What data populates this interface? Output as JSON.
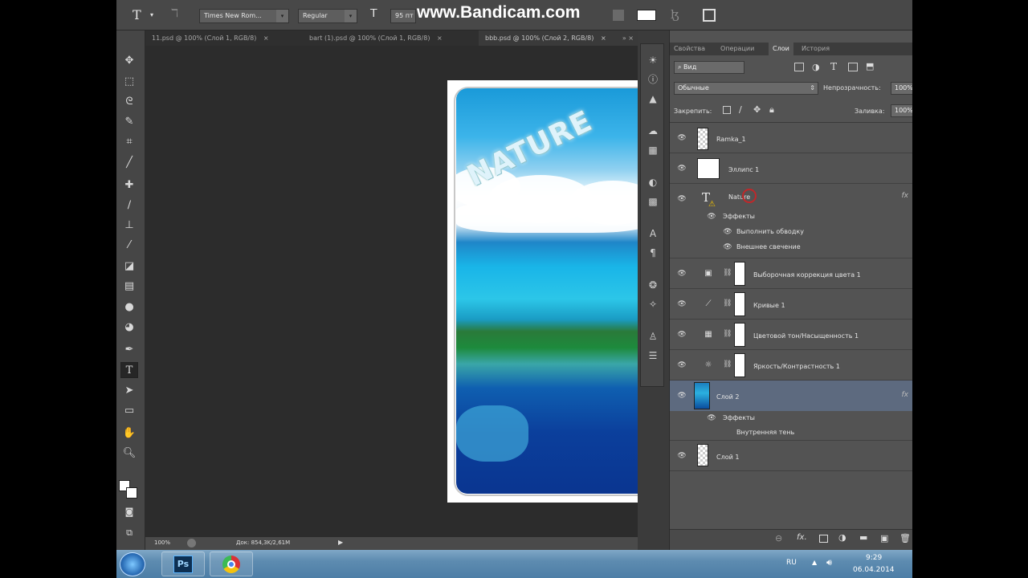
{
  "watermark": "www.Bandicam.com",
  "options_bar": {
    "tool_glyph": "T",
    "font_family": "Times New Rom...",
    "font_style": "Regular",
    "font_size": "95 пт"
  },
  "tabs": [
    {
      "label": "11.psd @ 100% (Слой 1, RGB/8)",
      "close": "×"
    },
    {
      "label": "bart (1).psd @ 100% (Слой 1, RGB/8)",
      "close": "×"
    },
    {
      "label": "bbb.psd @ 100% (Слой 2, RGB/8)",
      "close": "×"
    },
    {
      "label": "» ×"
    }
  ],
  "canvas": {
    "overlay_text": "NATURE"
  },
  "status": {
    "zoom": "100%",
    "doc_size": "Док: 854,3K/2,61M"
  },
  "panel": {
    "tabs": [
      "Свойства",
      "Операции",
      "Слои",
      "История"
    ],
    "active_tab": "Слои",
    "filter_label": "Вид",
    "blend_mode": "Обычные",
    "opacity_label": "Непрозрачность:",
    "opacity_value": "100%",
    "lock_label": "Закрепить:",
    "fill_label": "Заливка:",
    "fill_value": "100%",
    "layers": [
      {
        "name": "Ramka_1"
      },
      {
        "name": "Эллипс 1"
      },
      {
        "name": "Nature",
        "fx": "fx",
        "effects_label": "Эффекты",
        "effects": [
          "Выполнить обводку",
          "Внешнее свечение"
        ]
      },
      {
        "name": "Выборочная коррекция цвета 1"
      },
      {
        "name": "Кривые 1"
      },
      {
        "name": "Цветовой тон/Насыщенность 1"
      },
      {
        "name": "Яркость/Контрастность 1"
      },
      {
        "name": "Слой 2",
        "fx": "fx",
        "effects_label": "Эффекты",
        "effects": [
          "Внутренняя тень"
        ]
      },
      {
        "name": "Слой 1"
      }
    ]
  },
  "taskbar": {
    "lang": "RU",
    "time": "9:29",
    "date": "06.04.2014",
    "ps_label": "Ps"
  },
  "icons": [
    "move-icon",
    "marquee-icon",
    "lasso-icon",
    "quick-select-icon",
    "crop-icon",
    "eyedropper-icon",
    "healing-icon",
    "brush-icon",
    "stamp-icon",
    "history-brush-icon",
    "eraser-icon",
    "gradient-icon",
    "blur-icon",
    "dodge-icon",
    "pen-icon",
    "type-icon",
    "path-select-icon",
    "shape-icon",
    "hand-icon",
    "zoom-icon",
    "eye-icon",
    "link-icon",
    "start-icon",
    "chrome-icon"
  ]
}
